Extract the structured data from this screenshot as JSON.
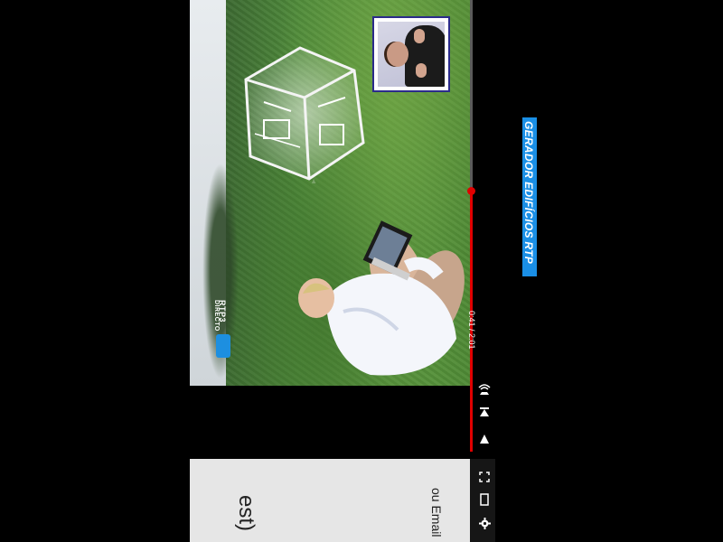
{
  "video": {
    "channel_logo": "RTP3",
    "channel_status": "DIRECTO"
  },
  "player": {
    "time_label": "0:41 / 2:01",
    "progress": 0.34
  },
  "caption": {
    "label": "GERADOR EDIFÍCIOS RTP",
    "color": "#1a8fe6"
  },
  "page": {
    "title_fragment": "est)",
    "email_fragment": "ou Email"
  },
  "icons": {
    "play": "play-icon",
    "next": "next-icon",
    "volume": "volume-icon",
    "fullscreen": "fullscreen-icon",
    "theater": "theater-icon",
    "settings": "settings-icon"
  },
  "colors": {
    "progress": "#e00000",
    "accent": "#1a8fe6"
  }
}
